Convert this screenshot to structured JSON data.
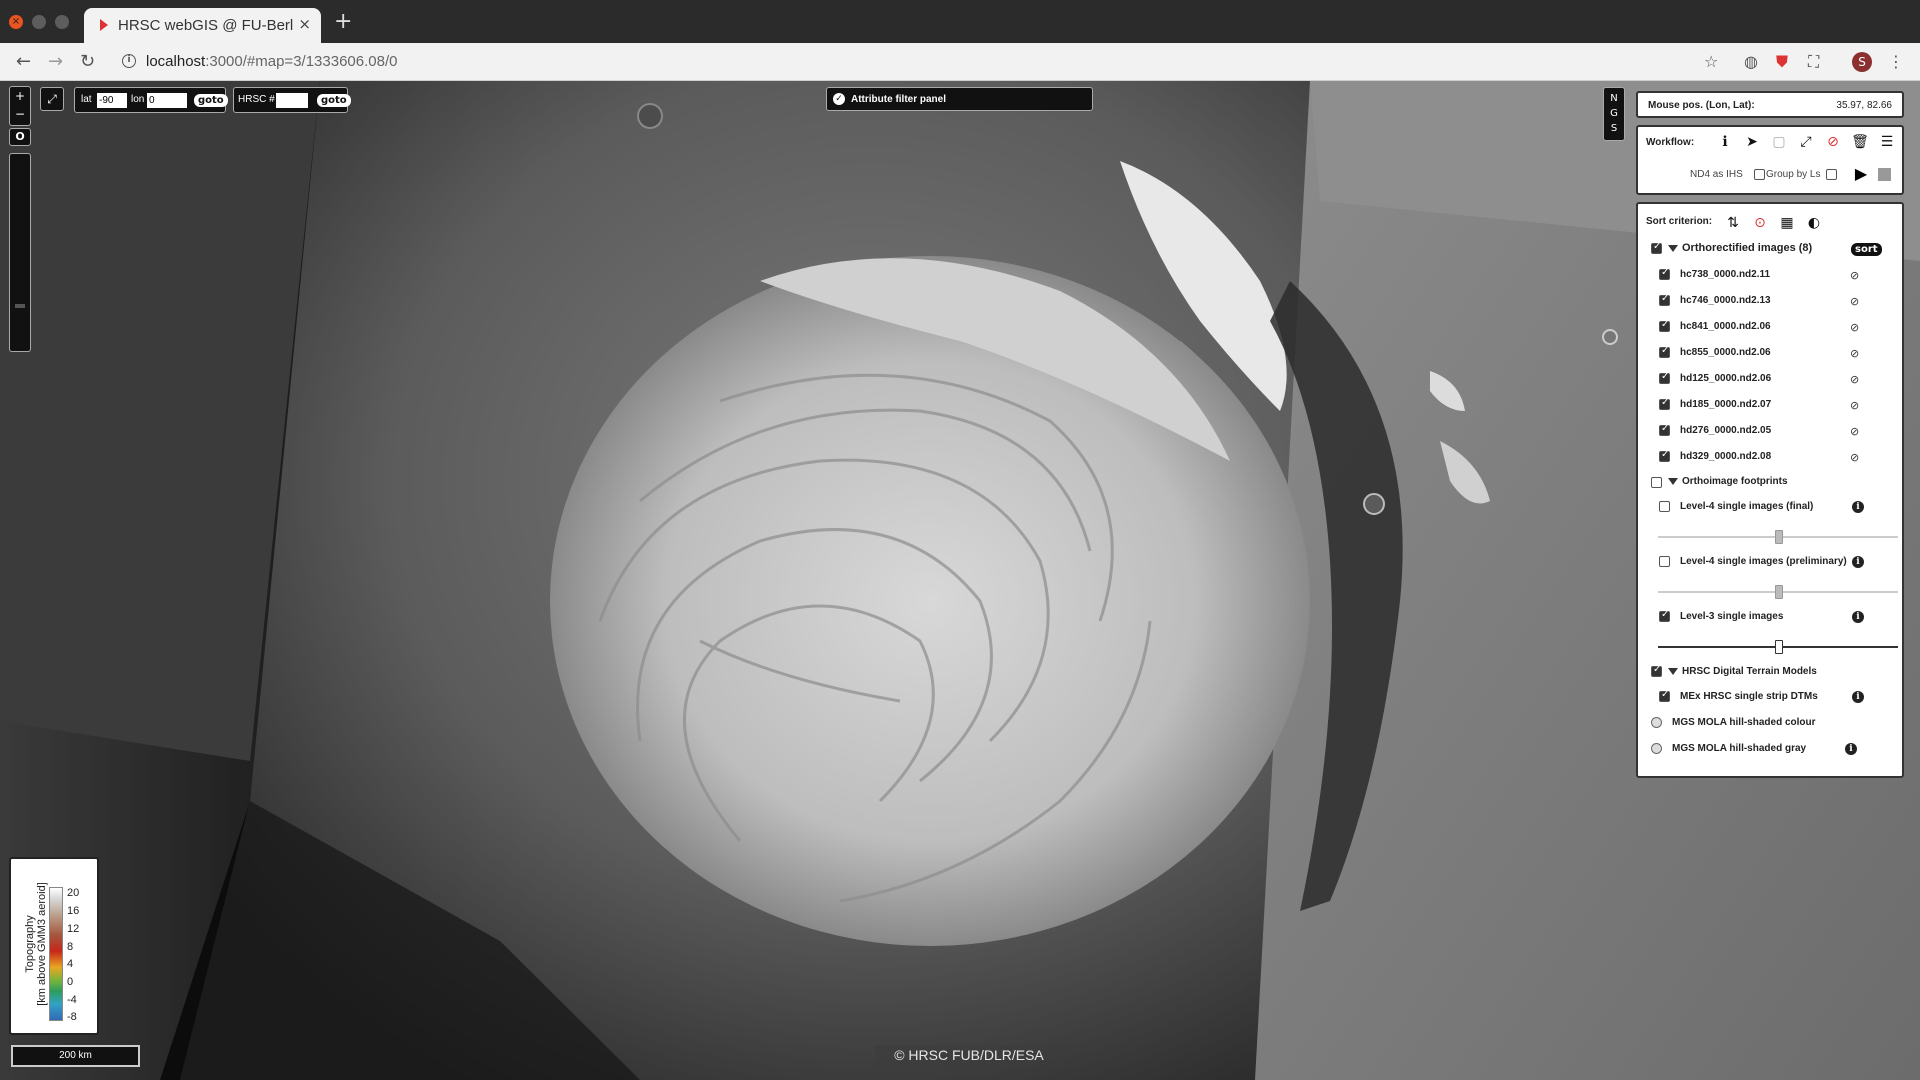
{
  "browser": {
    "tab_title": "HRSC webGIS @ FU-Berlin",
    "tab_close": "×",
    "new_tab": "+",
    "url_host": "localhost",
    "url_rest": ":3000/#map=3/1333606.08/0",
    "profile_initial": "S",
    "nav": {
      "back": "←",
      "forward": "→",
      "reload": "↻"
    }
  },
  "map_controls": {
    "zoom_in": "+",
    "zoom_out": "−",
    "fullscreen": "⤢",
    "rotate": "O",
    "lat_label": "lat",
    "lat_value": "-90",
    "lon_label": "lon",
    "lon_value": "0",
    "goto_label": "goto",
    "hrsc_label": "HRSC #",
    "hrsc_value": "",
    "compass": [
      "N",
      "G",
      "S"
    ]
  },
  "attribute_filter": {
    "label": "Attribute filter panel"
  },
  "mouse_pos": {
    "label": "Mouse pos. (Lon, Lat):",
    "value": "35.97, 82.66"
  },
  "workflow": {
    "label": "Workflow:",
    "nd4_label": "ND4 as IHS",
    "group_label": "Group by Ls",
    "icons": [
      "info-icon",
      "locate-icon",
      "select-icon",
      "expand-icon",
      "hide-icon",
      "delete-icon",
      "menu-icon"
    ]
  },
  "layers": {
    "sort_label": "Sort criterion:",
    "sort_button": "sort",
    "ortho_group": "Orthorectified images (8)",
    "ortho_items": [
      "hc738_0000.nd2.11",
      "hc746_0000.nd2.13",
      "hc841_0000.nd2.06",
      "hc855_0000.nd2.06",
      "hd125_0000.nd2.06",
      "hd185_0000.nd2.07",
      "hd276_0000.nd2.05",
      "hd329_0000.nd2.08"
    ],
    "footprints_group": "Orthoimage footprints",
    "footprint_items": [
      {
        "label": "Level-4 single images (final)",
        "checked": false
      },
      {
        "label": "Level-4 single images (preliminary)",
        "checked": false
      },
      {
        "label": "Level-3 single images",
        "checked": true
      }
    ],
    "dtm_group": "HRSC Digital Terrain Models",
    "dtm_item": "MEx HRSC single strip DTMs",
    "base_layers": [
      "MGS MOLA hill-shaded colour",
      "MGS MOLA hill-shaded gray"
    ]
  },
  "legend": {
    "title_line1": "Topography",
    "title_line2": "[km above GMM3 aeroid]",
    "ticks": [
      "20",
      "16",
      "12",
      "8",
      "4",
      "0",
      "-4",
      "-8"
    ]
  },
  "scale_bar": "200 km",
  "copyright": "© HRSC FUB/DLR/ESA"
}
